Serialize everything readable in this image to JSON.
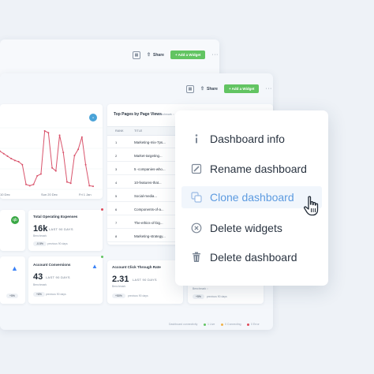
{
  "back_window": {
    "share_label": "Share",
    "add_widget_label": "+ Add a Widget",
    "more_label": "···"
  },
  "front_window": {
    "share_label": "Share",
    "add_widget_label": "+ Add a Widget",
    "more_label": "···"
  },
  "line_chart": {
    "x_ticks": [
      "10 Dec",
      "Sun 20 Dec",
      "Fri 1 Jan"
    ]
  },
  "chart_data": {
    "type": "line",
    "x": [
      0,
      1,
      2,
      3,
      4,
      5,
      6,
      7,
      8,
      9,
      10,
      11,
      12,
      13,
      14,
      15,
      16,
      17,
      18,
      19,
      20,
      21,
      22,
      23,
      24,
      25
    ],
    "series": [
      {
        "values": [
          0.62,
          0.58,
          0.54,
          0.5,
          0.47,
          0.45,
          0.4,
          0.08,
          0.06,
          0.08,
          0.22,
          0.25,
          0.95,
          0.92,
          0.35,
          0.3,
          0.88,
          0.6,
          0.12,
          0.1,
          0.55,
          0.65,
          0.85,
          0.4,
          0.06,
          0.05
        ]
      }
    ],
    "xticks": [
      "10 Dec",
      "Sun 20 Dec",
      "Fri 1 Jan"
    ],
    "color": "#d9536b",
    "grid": true
  },
  "top_pages": {
    "title": "Top Pages by Page Views",
    "subtitle": "Benchmark ::",
    "col_rank": "RANK",
    "col_title": "TITLE",
    "rows": [
      {
        "rank": "1",
        "title": "Marketing-mix-7ps..."
      },
      {
        "rank": "2",
        "title": "Market-targeting..."
      },
      {
        "rank": "3",
        "title": "5 -companies-who..."
      },
      {
        "rank": "4",
        "title": "10-features-that..."
      },
      {
        "rank": "5",
        "title": "Social-media..."
      },
      {
        "rank": "6",
        "title": "Components-of-a..."
      },
      {
        "rank": "7",
        "title": "The-ethics-of-big..."
      },
      {
        "rank": "8",
        "title": "Marketing-strategy..."
      }
    ]
  },
  "metrics": [
    {
      "title": "Total Operating Expenses",
      "value": "16k",
      "period": "LAST 90 DAYS",
      "sub": "Benchmark",
      "badge": "-0.5%",
      "prev": "previous 90 days"
    },
    {
      "title": "Account Conversions",
      "value": "43",
      "period": "LAST 90 DAYS",
      "sub": "Benchmark",
      "badge": "+6%",
      "prev": "previous 90 days"
    },
    {
      "title": "Account Click Through Rate",
      "value": "2.31",
      "period": "LAST 90 DAYS",
      "sub": "Benchmark",
      "badge": "+50%",
      "prev": "previous 90 days"
    },
    {
      "title": "",
      "value": "",
      "period": "",
      "sub": "Benchmark ::",
      "badge": "+5%",
      "prev": "previous 90 days"
    }
  ],
  "left_metrics": [
    {
      "badge": "+5%",
      "prev": "previous 90 days"
    }
  ],
  "footer": {
    "label": "Dashboard connectivity",
    "ok": "1 Live",
    "warn": "0 Connecting",
    "err": "0 Error"
  },
  "menu": {
    "items": [
      {
        "label": "Dashboard info",
        "icon": "info-icon"
      },
      {
        "label": "Rename dashboard",
        "icon": "pencil-icon"
      },
      {
        "label": "Clone dashboard",
        "icon": "clone-icon"
      },
      {
        "label": "Delete widgets",
        "icon": "close-circle-icon"
      },
      {
        "label": "Delete dashboard",
        "icon": "trash-icon"
      }
    ]
  },
  "colors": {
    "accent_green": "#62c462",
    "line_red": "#d9536b",
    "menu_active": "#5d9be0"
  }
}
